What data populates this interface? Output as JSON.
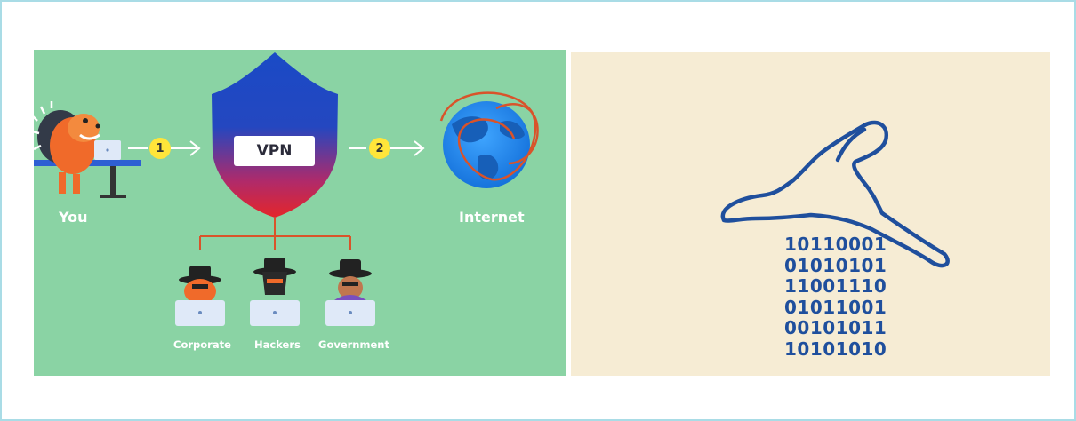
{
  "left_panel": {
    "you_label": "You",
    "vpn_label": "VPN",
    "internet_label": "Internet",
    "step_1": "1",
    "step_2": "2",
    "observers": [
      {
        "label": "Corporate"
      },
      {
        "label": "Hackers"
      },
      {
        "label": "Government"
      }
    ],
    "colors": {
      "background": "#8ad3a4",
      "shield": "#1d4fc4",
      "step_badge": "#ffe53a",
      "connector": "#d9532a"
    }
  },
  "right_panel": {
    "binary_lines": [
      "10110001",
      "01010101",
      "11001110",
      "01011001",
      "00101011",
      "10101010"
    ],
    "colors": {
      "background": "#f6ecd4",
      "rabbit_outline": "#1f4f9d",
      "binary_text": "#1f4f9d"
    }
  }
}
